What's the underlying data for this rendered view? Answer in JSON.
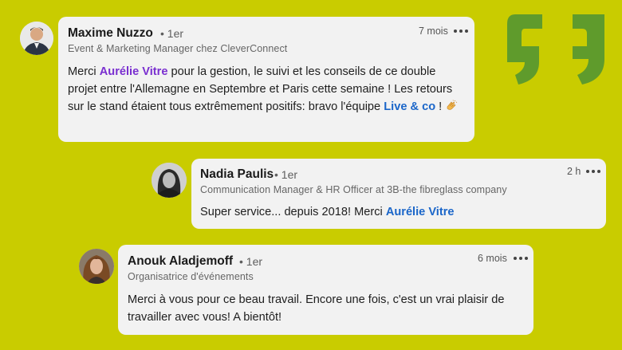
{
  "comments": [
    {
      "author": "Maxime Nuzzo",
      "degree": "• 1er",
      "role": "Event & Marketing Manager chez CleverConnect",
      "time": "7 mois",
      "text_1": "Merci ",
      "mention_1": "Aurélie Vitre",
      "text_2": " pour la gestion, le suivi et les conseils de ce double projet entre l'Allemagne en Septembre et Paris cette semaine ! Les retours sur le stand étaient tous extrêmement positifs: bravo l'équipe ",
      "mention_2": "Live & co",
      "text_3": " ! ",
      "emoji": "clapping-hands-icon"
    },
    {
      "author": "Nadia Paulis",
      "degree": "• 1er",
      "role": "Communication Manager & HR Officer at 3B-the fibreglass company",
      "time": "2 h",
      "text_1": "Super service... depuis 2018! Merci ",
      "mention_1": "Aurélie Vitre"
    },
    {
      "author": "Anouk Aladjemoff",
      "degree": "• 1er",
      "role": "Organisatrice d'événements",
      "time": "6 mois",
      "text_1": "Merci à vous pour ce beau travail. Encore une fois, c'est un vrai plaisir de travailler avec vous! A bientôt!"
    }
  ],
  "colors": {
    "background": "#c9cc00",
    "quote": "#5f9b2c",
    "card": "#f2f2f2",
    "mention_purple": "#7a2fd0",
    "mention_blue": "#1b66c9"
  },
  "decorations": [
    "quote-open-icon",
    "quote-close-icon"
  ]
}
